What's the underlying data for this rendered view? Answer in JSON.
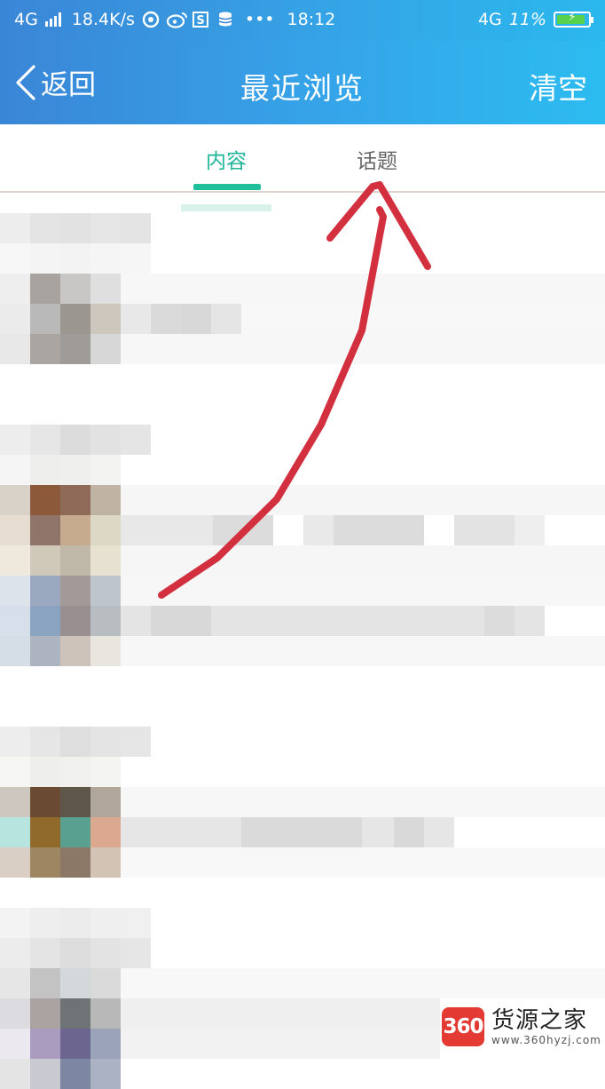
{
  "status_bar": {
    "network_left": "4G",
    "speed": "18.4K/s",
    "icons": [
      "netease-music-icon",
      "weibo-icon",
      "s-app-icon",
      "database-icon"
    ],
    "more": "•••",
    "time": "18:12",
    "network_right": "4G",
    "battery_text": "11%",
    "battery_level": 0.11
  },
  "header": {
    "back_label": "返回",
    "title": "最近浏览",
    "clear_label": "清空"
  },
  "tabs": [
    {
      "label": "内容",
      "selected": true
    },
    {
      "label": "话题",
      "selected": false
    }
  ],
  "colors": {
    "header_start": "#3a86d6",
    "header_end": "#2cbcf0",
    "tab_accent": "#1fbf9c",
    "annotation": "#d3303f"
  },
  "watermark": {
    "logo": "360",
    "name": "货源之家",
    "url": "www.360hyzj.com"
  }
}
